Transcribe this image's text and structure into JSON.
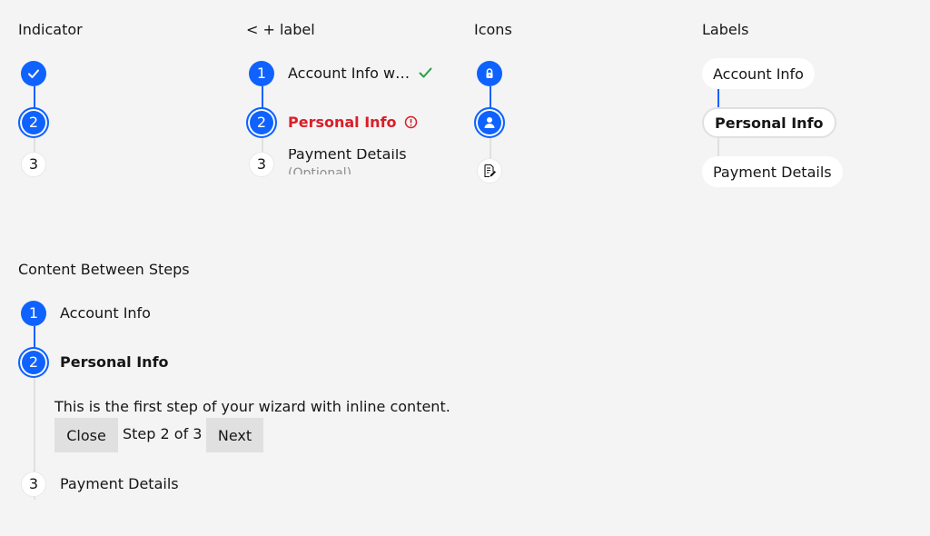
{
  "indicator": {
    "title": "Indicator",
    "steps": [
      {
        "number": "1",
        "state": "done",
        "icon": "checkmark-icon"
      },
      {
        "number": "2",
        "state": "active"
      },
      {
        "number": "3",
        "state": "pending"
      }
    ]
  },
  "number_label": {
    "title": "< + label",
    "steps": [
      {
        "number": "1",
        "label": "Account Info w…",
        "status_icon": "check-icon"
      },
      {
        "number": "2",
        "label": "Personal Info",
        "status_icon": "error-icon"
      },
      {
        "number": "3",
        "label": "Payment Details",
        "sublabel": "(Optional)"
      }
    ]
  },
  "icons": {
    "title": "Icons",
    "steps": [
      {
        "icon": "lock-icon",
        "state": "done"
      },
      {
        "icon": "user-icon",
        "state": "active"
      },
      {
        "icon": "document-edit-icon",
        "state": "pending"
      }
    ]
  },
  "labels": {
    "title": "Labels",
    "steps": [
      {
        "label": "Account Info"
      },
      {
        "label": "Personal Info"
      },
      {
        "label": "Payment Details"
      }
    ]
  },
  "content_between": {
    "title": "Content Between Steps",
    "steps": [
      {
        "number": "1",
        "label": "Account Info"
      },
      {
        "number": "2",
        "label": "Personal Info"
      },
      {
        "number": "3",
        "label": "Payment Details"
      }
    ],
    "content_text": "This is the first step of your wizard with inline content.",
    "close_label": "Close",
    "step_counter": "Step 2 of 3",
    "next_label": "Next"
  },
  "colors": {
    "primary": "#0f62fe",
    "error": "#da1e28",
    "success": "#24a148",
    "background": "#f4f4f4"
  }
}
